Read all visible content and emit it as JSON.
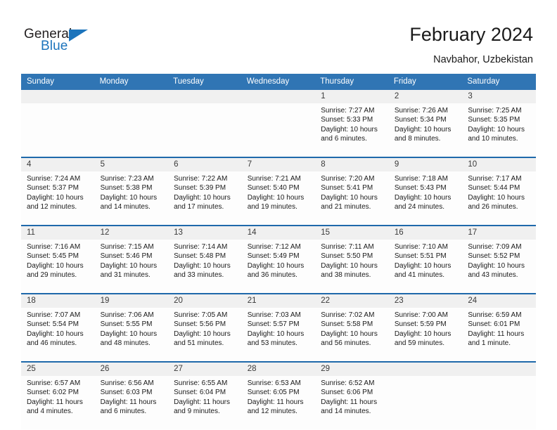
{
  "brand": {
    "name_part1": "General",
    "name_part2": "Blue",
    "accent_color": "#1c74bc"
  },
  "header": {
    "title": "February 2024",
    "subtitle": "Navbahor, Uzbekistan"
  },
  "calendar": {
    "header_bg": "#3075b4",
    "date_band_bg": "#f0f0f0",
    "week_separator_color": "#1f69ab",
    "weekdays": [
      "Sunday",
      "Monday",
      "Tuesday",
      "Wednesday",
      "Thursday",
      "Friday",
      "Saturday"
    ],
    "weeks": [
      {
        "dates": [
          "",
          "",
          "",
          "",
          "1",
          "2",
          "3"
        ],
        "cells": [
          {
            "sunrise": "",
            "sunset": "",
            "daylight1": "",
            "daylight2": ""
          },
          {
            "sunrise": "",
            "sunset": "",
            "daylight1": "",
            "daylight2": ""
          },
          {
            "sunrise": "",
            "sunset": "",
            "daylight1": "",
            "daylight2": ""
          },
          {
            "sunrise": "",
            "sunset": "",
            "daylight1": "",
            "daylight2": ""
          },
          {
            "sunrise": "Sunrise: 7:27 AM",
            "sunset": "Sunset: 5:33 PM",
            "daylight1": "Daylight: 10 hours",
            "daylight2": "and 6 minutes."
          },
          {
            "sunrise": "Sunrise: 7:26 AM",
            "sunset": "Sunset: 5:34 PM",
            "daylight1": "Daylight: 10 hours",
            "daylight2": "and 8 minutes."
          },
          {
            "sunrise": "Sunrise: 7:25 AM",
            "sunset": "Sunset: 5:35 PM",
            "daylight1": "Daylight: 10 hours",
            "daylight2": "and 10 minutes."
          }
        ]
      },
      {
        "dates": [
          "4",
          "5",
          "6",
          "7",
          "8",
          "9",
          "10"
        ],
        "cells": [
          {
            "sunrise": "Sunrise: 7:24 AM",
            "sunset": "Sunset: 5:37 PM",
            "daylight1": "Daylight: 10 hours",
            "daylight2": "and 12 minutes."
          },
          {
            "sunrise": "Sunrise: 7:23 AM",
            "sunset": "Sunset: 5:38 PM",
            "daylight1": "Daylight: 10 hours",
            "daylight2": "and 14 minutes."
          },
          {
            "sunrise": "Sunrise: 7:22 AM",
            "sunset": "Sunset: 5:39 PM",
            "daylight1": "Daylight: 10 hours",
            "daylight2": "and 17 minutes."
          },
          {
            "sunrise": "Sunrise: 7:21 AM",
            "sunset": "Sunset: 5:40 PM",
            "daylight1": "Daylight: 10 hours",
            "daylight2": "and 19 minutes."
          },
          {
            "sunrise": "Sunrise: 7:20 AM",
            "sunset": "Sunset: 5:41 PM",
            "daylight1": "Daylight: 10 hours",
            "daylight2": "and 21 minutes."
          },
          {
            "sunrise": "Sunrise: 7:18 AM",
            "sunset": "Sunset: 5:43 PM",
            "daylight1": "Daylight: 10 hours",
            "daylight2": "and 24 minutes."
          },
          {
            "sunrise": "Sunrise: 7:17 AM",
            "sunset": "Sunset: 5:44 PM",
            "daylight1": "Daylight: 10 hours",
            "daylight2": "and 26 minutes."
          }
        ]
      },
      {
        "dates": [
          "11",
          "12",
          "13",
          "14",
          "15",
          "16",
          "17"
        ],
        "cells": [
          {
            "sunrise": "Sunrise: 7:16 AM",
            "sunset": "Sunset: 5:45 PM",
            "daylight1": "Daylight: 10 hours",
            "daylight2": "and 29 minutes."
          },
          {
            "sunrise": "Sunrise: 7:15 AM",
            "sunset": "Sunset: 5:46 PM",
            "daylight1": "Daylight: 10 hours",
            "daylight2": "and 31 minutes."
          },
          {
            "sunrise": "Sunrise: 7:14 AM",
            "sunset": "Sunset: 5:48 PM",
            "daylight1": "Daylight: 10 hours",
            "daylight2": "and 33 minutes."
          },
          {
            "sunrise": "Sunrise: 7:12 AM",
            "sunset": "Sunset: 5:49 PM",
            "daylight1": "Daylight: 10 hours",
            "daylight2": "and 36 minutes."
          },
          {
            "sunrise": "Sunrise: 7:11 AM",
            "sunset": "Sunset: 5:50 PM",
            "daylight1": "Daylight: 10 hours",
            "daylight2": "and 38 minutes."
          },
          {
            "sunrise": "Sunrise: 7:10 AM",
            "sunset": "Sunset: 5:51 PM",
            "daylight1": "Daylight: 10 hours",
            "daylight2": "and 41 minutes."
          },
          {
            "sunrise": "Sunrise: 7:09 AM",
            "sunset": "Sunset: 5:52 PM",
            "daylight1": "Daylight: 10 hours",
            "daylight2": "and 43 minutes."
          }
        ]
      },
      {
        "dates": [
          "18",
          "19",
          "20",
          "21",
          "22",
          "23",
          "24"
        ],
        "cells": [
          {
            "sunrise": "Sunrise: 7:07 AM",
            "sunset": "Sunset: 5:54 PM",
            "daylight1": "Daylight: 10 hours",
            "daylight2": "and 46 minutes."
          },
          {
            "sunrise": "Sunrise: 7:06 AM",
            "sunset": "Sunset: 5:55 PM",
            "daylight1": "Daylight: 10 hours",
            "daylight2": "and 48 minutes."
          },
          {
            "sunrise": "Sunrise: 7:05 AM",
            "sunset": "Sunset: 5:56 PM",
            "daylight1": "Daylight: 10 hours",
            "daylight2": "and 51 minutes."
          },
          {
            "sunrise": "Sunrise: 7:03 AM",
            "sunset": "Sunset: 5:57 PM",
            "daylight1": "Daylight: 10 hours",
            "daylight2": "and 53 minutes."
          },
          {
            "sunrise": "Sunrise: 7:02 AM",
            "sunset": "Sunset: 5:58 PM",
            "daylight1": "Daylight: 10 hours",
            "daylight2": "and 56 minutes."
          },
          {
            "sunrise": "Sunrise: 7:00 AM",
            "sunset": "Sunset: 5:59 PM",
            "daylight1": "Daylight: 10 hours",
            "daylight2": "and 59 minutes."
          },
          {
            "sunrise": "Sunrise: 6:59 AM",
            "sunset": "Sunset: 6:01 PM",
            "daylight1": "Daylight: 11 hours",
            "daylight2": "and 1 minute."
          }
        ]
      },
      {
        "dates": [
          "25",
          "26",
          "27",
          "28",
          "29",
          "",
          ""
        ],
        "cells": [
          {
            "sunrise": "Sunrise: 6:57 AM",
            "sunset": "Sunset: 6:02 PM",
            "daylight1": "Daylight: 11 hours",
            "daylight2": "and 4 minutes."
          },
          {
            "sunrise": "Sunrise: 6:56 AM",
            "sunset": "Sunset: 6:03 PM",
            "daylight1": "Daylight: 11 hours",
            "daylight2": "and 6 minutes."
          },
          {
            "sunrise": "Sunrise: 6:55 AM",
            "sunset": "Sunset: 6:04 PM",
            "daylight1": "Daylight: 11 hours",
            "daylight2": "and 9 minutes."
          },
          {
            "sunrise": "Sunrise: 6:53 AM",
            "sunset": "Sunset: 6:05 PM",
            "daylight1": "Daylight: 11 hours",
            "daylight2": "and 12 minutes."
          },
          {
            "sunrise": "Sunrise: 6:52 AM",
            "sunset": "Sunset: 6:06 PM",
            "daylight1": "Daylight: 11 hours",
            "daylight2": "and 14 minutes."
          },
          {
            "sunrise": "",
            "sunset": "",
            "daylight1": "",
            "daylight2": ""
          },
          {
            "sunrise": "",
            "sunset": "",
            "daylight1": "",
            "daylight2": ""
          }
        ]
      }
    ]
  }
}
